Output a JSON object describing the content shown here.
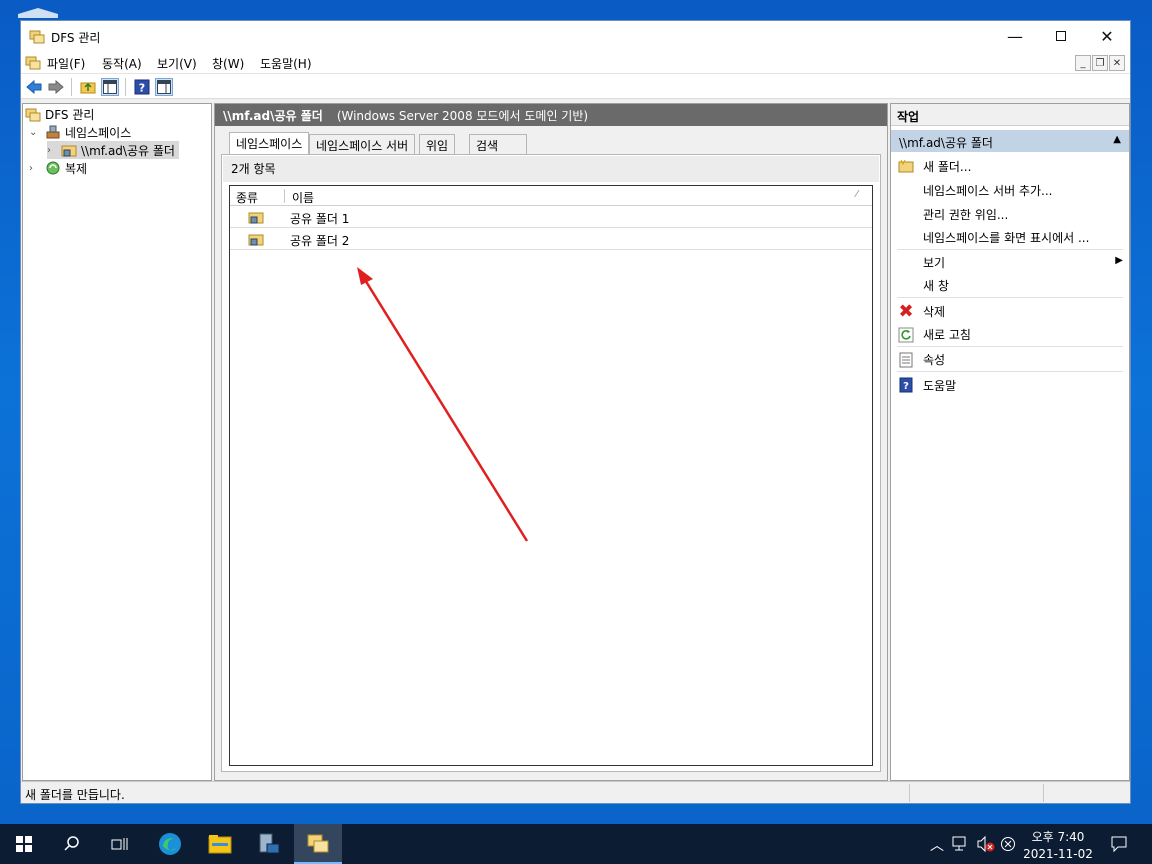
{
  "window": {
    "title": "DFS 관리",
    "min_icon": "minimize-icon",
    "max_icon": "maximize-icon",
    "close_icon": "close-icon"
  },
  "menubar": {
    "items": [
      "파일(F)",
      "동작(A)",
      "보기(V)",
      "창(W)",
      "도움말(H)"
    ]
  },
  "tree": {
    "root": "DFS 관리",
    "namespaces": "네임스페이스",
    "namespace_item": "\\\\mf.ad\\공유 폴더",
    "replication": "복제"
  },
  "center": {
    "header_path": "\\\\mf.ad\\공유 폴더",
    "header_desc": "(Windows Server 2008 모드에서 도메인 기반)",
    "tabs": [
      "네임스페이스",
      "네임스페이스 서버",
      "위임",
      "검색"
    ],
    "count": "2개 항목",
    "columns": [
      "종류",
      "이름"
    ],
    "rows": [
      {
        "name": "공유 폴더 1"
      },
      {
        "name": "공유 폴더 2"
      }
    ]
  },
  "actions": {
    "title": "작업",
    "section": "\\\\mf.ad\\공유 폴더",
    "items": [
      "새 폴더...",
      "네임스페이스 서버 추가...",
      "관리 권한 위임...",
      "네임스페이스를 화면 표시에서 ...",
      "보기",
      "새 창",
      "삭제",
      "새로 고침",
      "속성",
      "도움말"
    ]
  },
  "statusbar": {
    "text": "새 폴더를 만듭니다."
  },
  "taskbar": {
    "time_period": "오후 7:40",
    "date": "2021-11-02"
  },
  "colors": {
    "accent": "#0078d7",
    "arrow": "#e02020",
    "action_header": "#c3d3e6",
    "center_header": "#6a6a6a"
  }
}
